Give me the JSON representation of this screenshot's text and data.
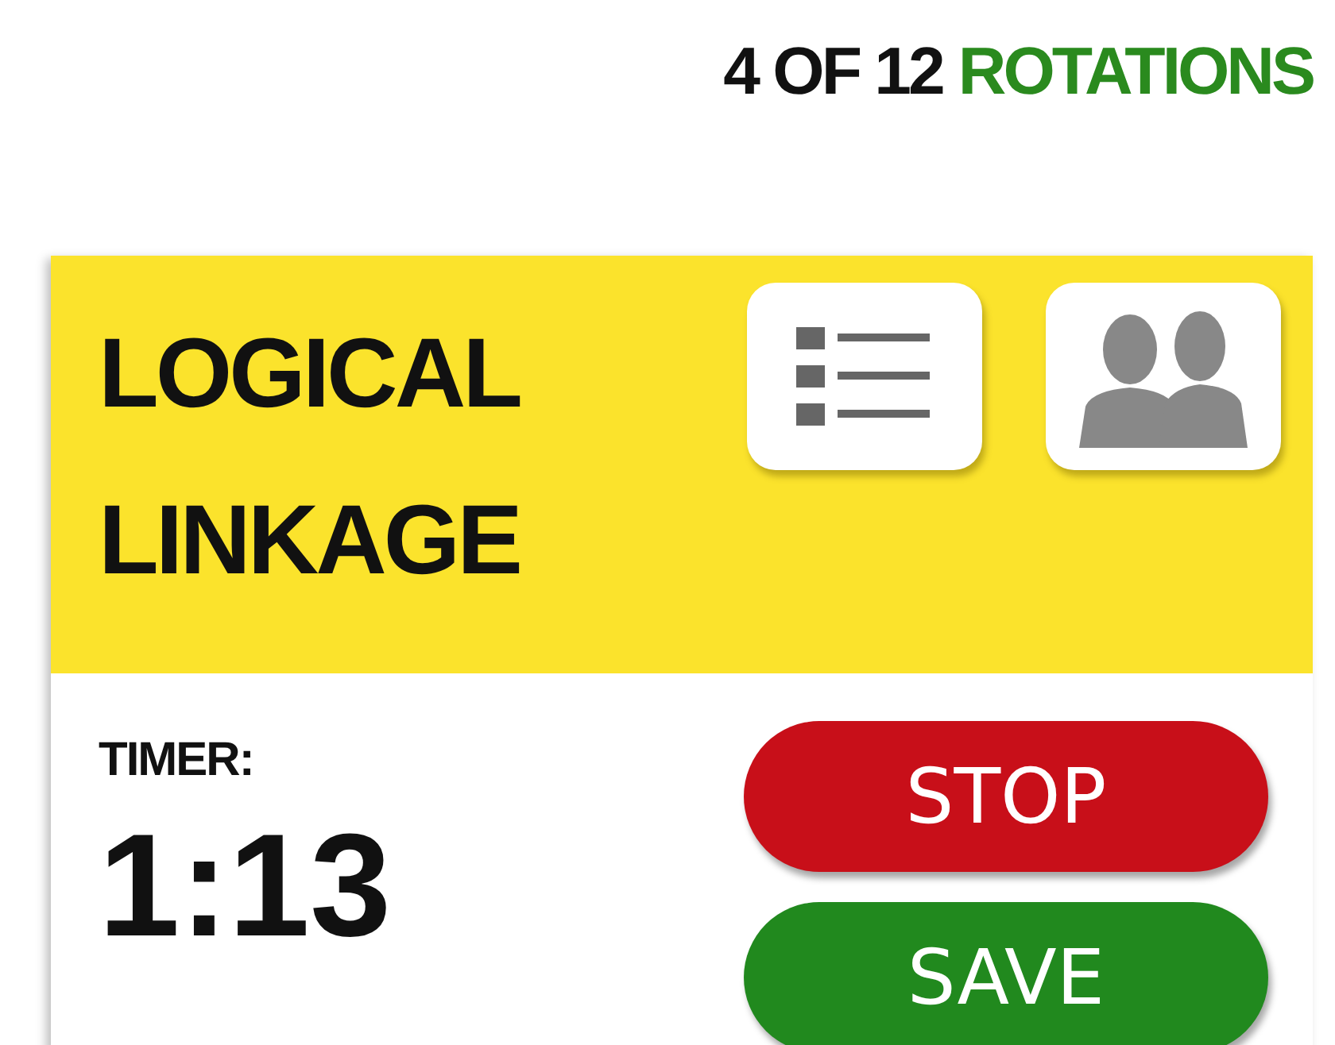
{
  "counter": {
    "text": "4 OF 12",
    "highlight": "ROTATIONS"
  },
  "card": {
    "title": "LOGICAL LINKAGE",
    "icon_buttons": [
      {
        "kind": "list"
      },
      {
        "kind": "people"
      }
    ],
    "timer": {
      "label": "TIMER:",
      "value": "1:13"
    },
    "buttons": [
      {
        "label": "STOP",
        "kind": "stop"
      },
      {
        "label": "SAVE",
        "kind": "save"
      }
    ]
  }
}
